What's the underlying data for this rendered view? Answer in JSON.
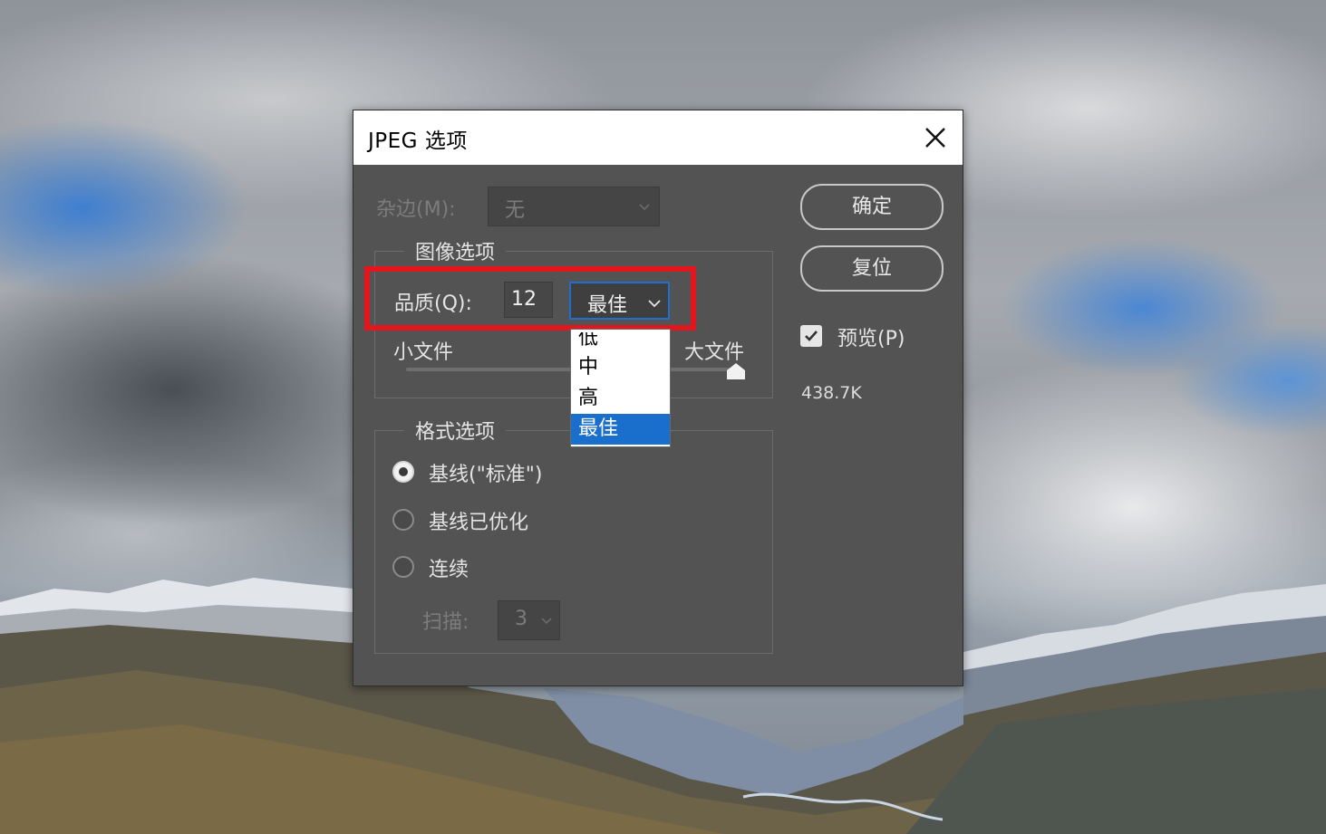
{
  "dialog": {
    "title": "JPEG 选项",
    "matte": {
      "label": "杂边(M):",
      "value": "无"
    },
    "image_options": {
      "legend": "图像选项",
      "quality_label": "品质(Q):",
      "quality_value": "12",
      "quality_preset": "最佳",
      "preset_options": [
        "低",
        "中",
        "高",
        "最佳"
      ],
      "selected_option_index": 3,
      "small_file_label": "小文件",
      "large_file_label": "大文件",
      "slider_level_fraction": 1.0
    },
    "format_options": {
      "legend": "格式选项",
      "radio_baseline_standard": "基线(\"标准\")",
      "radio_baseline_optimized": "基线已优化",
      "radio_progressive": "连续",
      "scans_label": "扫描:",
      "scans_value": "3",
      "selected": "基线(\"标准\")"
    },
    "buttons": {
      "ok": "确定",
      "reset": "复位"
    },
    "preview": {
      "label": "预览(P)",
      "checked": true
    },
    "file_size": "438.7K"
  },
  "colors": {
    "dialog_bg": "#535353",
    "highlight_box": "#e3161d",
    "selection_blue": "#1a6fcd"
  },
  "icons": [
    "close-icon",
    "chevron-down-icon",
    "checkmark-icon",
    "slider-thumb-icon"
  ]
}
